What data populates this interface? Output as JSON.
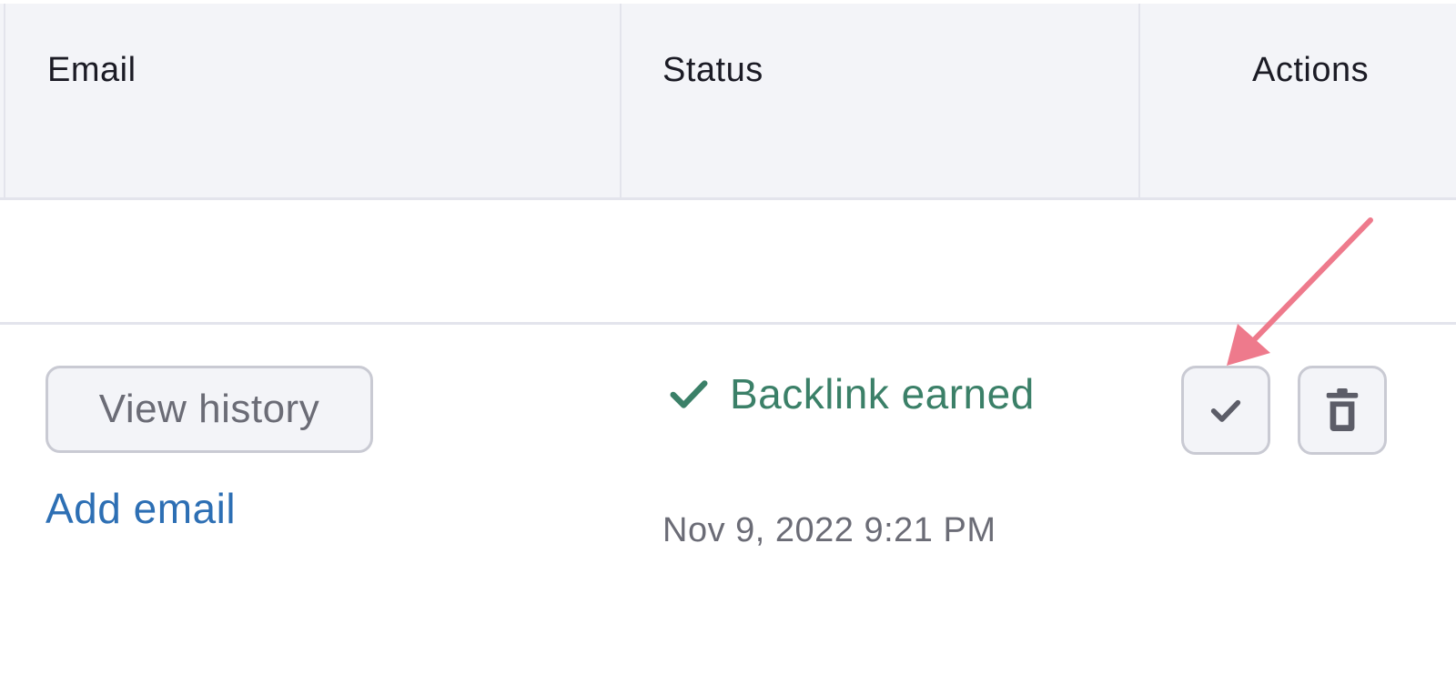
{
  "table": {
    "headers": {
      "email": "Email",
      "status": "Status",
      "actions": "Actions"
    },
    "row": {
      "view_history_label": "View history",
      "add_email_label": "Add email",
      "status_text": "Backlink earned",
      "timestamp": "Nov 9, 2022 9:21 PM"
    }
  },
  "colors": {
    "status_success": "#3b8068",
    "link": "#2d6fb4",
    "annotation_arrow": "#ee7a8c"
  },
  "icons": {
    "status": "check-icon",
    "mark_button": "check-icon",
    "delete_button": "trash-icon",
    "annotation": "arrow-icon"
  }
}
